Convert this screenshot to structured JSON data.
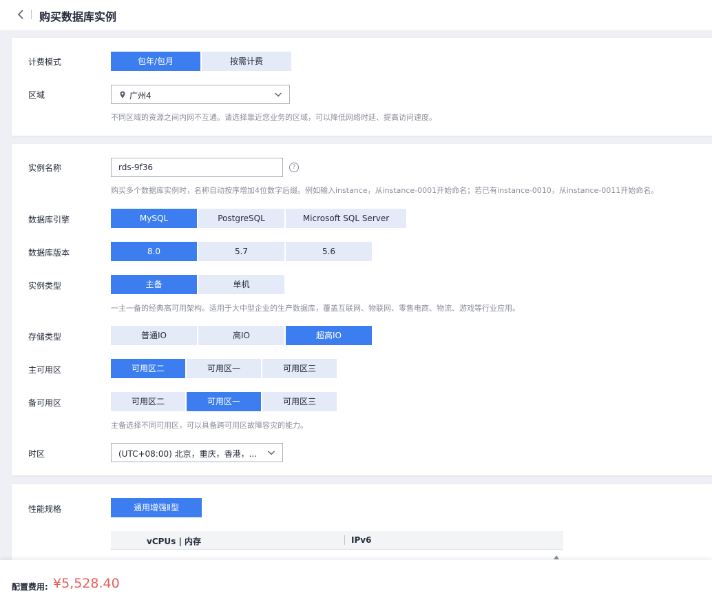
{
  "header": {
    "title": "购买数据库实例"
  },
  "billing": {
    "label": "计费模式",
    "options": [
      "包年/包月",
      "按需计费"
    ],
    "selected": "包年/包月"
  },
  "region": {
    "label": "区域",
    "value": "广州4",
    "hint": "不同区域的资源之间内网不互通。请选择靠近您业务的区域，可以降低网络时延、提高访问速度。"
  },
  "instance_name": {
    "label": "实例名称",
    "value": "rds-9f36",
    "help": "?",
    "hint": "购买多个数据库实例时，名称自动按序增加4位数字后缀。例如输入instance，从instance-0001开始命名；若已有instance-0010，从instance-0011开始命名。"
  },
  "engine": {
    "label": "数据库引擎",
    "options": [
      "MySQL",
      "PostgreSQL",
      "Microsoft SQL Server"
    ],
    "selected": "MySQL"
  },
  "version": {
    "label": "数据库版本",
    "options": [
      "8.0",
      "5.7",
      "5.6"
    ],
    "selected": "8.0"
  },
  "instance_type": {
    "label": "实例类型",
    "options": [
      "主备",
      "单机"
    ],
    "selected": "主备",
    "hint": "一主一备的经典高可用架构。适用于大中型企业的生产数据库，覆盖互联网、物联网、零售电商、物流、游戏等行业应用。"
  },
  "storage": {
    "label": "存储类型",
    "options": [
      "普通IO",
      "高IO",
      "超高IO"
    ],
    "selected": "超高IO"
  },
  "primary_az": {
    "label": "主可用区",
    "options": [
      "可用区二",
      "可用区一",
      "可用区三"
    ],
    "selected": "可用区二"
  },
  "standby_az": {
    "label": "备可用区",
    "options": [
      "可用区二",
      "可用区一",
      "可用区三"
    ],
    "selected": "可用区一",
    "hint": "主备选择不同可用区，可以具备跨可用区故障容灾的能力。"
  },
  "timezone": {
    "label": "时区",
    "value": "(UTC+08:00) 北京，重庆，香港，..."
  },
  "spec": {
    "label": "性能规格",
    "tab": "通用增强Ⅱ型",
    "columns": [
      "vCPUs | 内存",
      "IPv6"
    ]
  },
  "footer": {
    "fee_label": "配置费用:",
    "fee_value": "¥5,528.40"
  },
  "colors": {
    "primary": "#3c7ef0",
    "segment_bg": "#e4eaf7",
    "price": "#e45f5f"
  }
}
